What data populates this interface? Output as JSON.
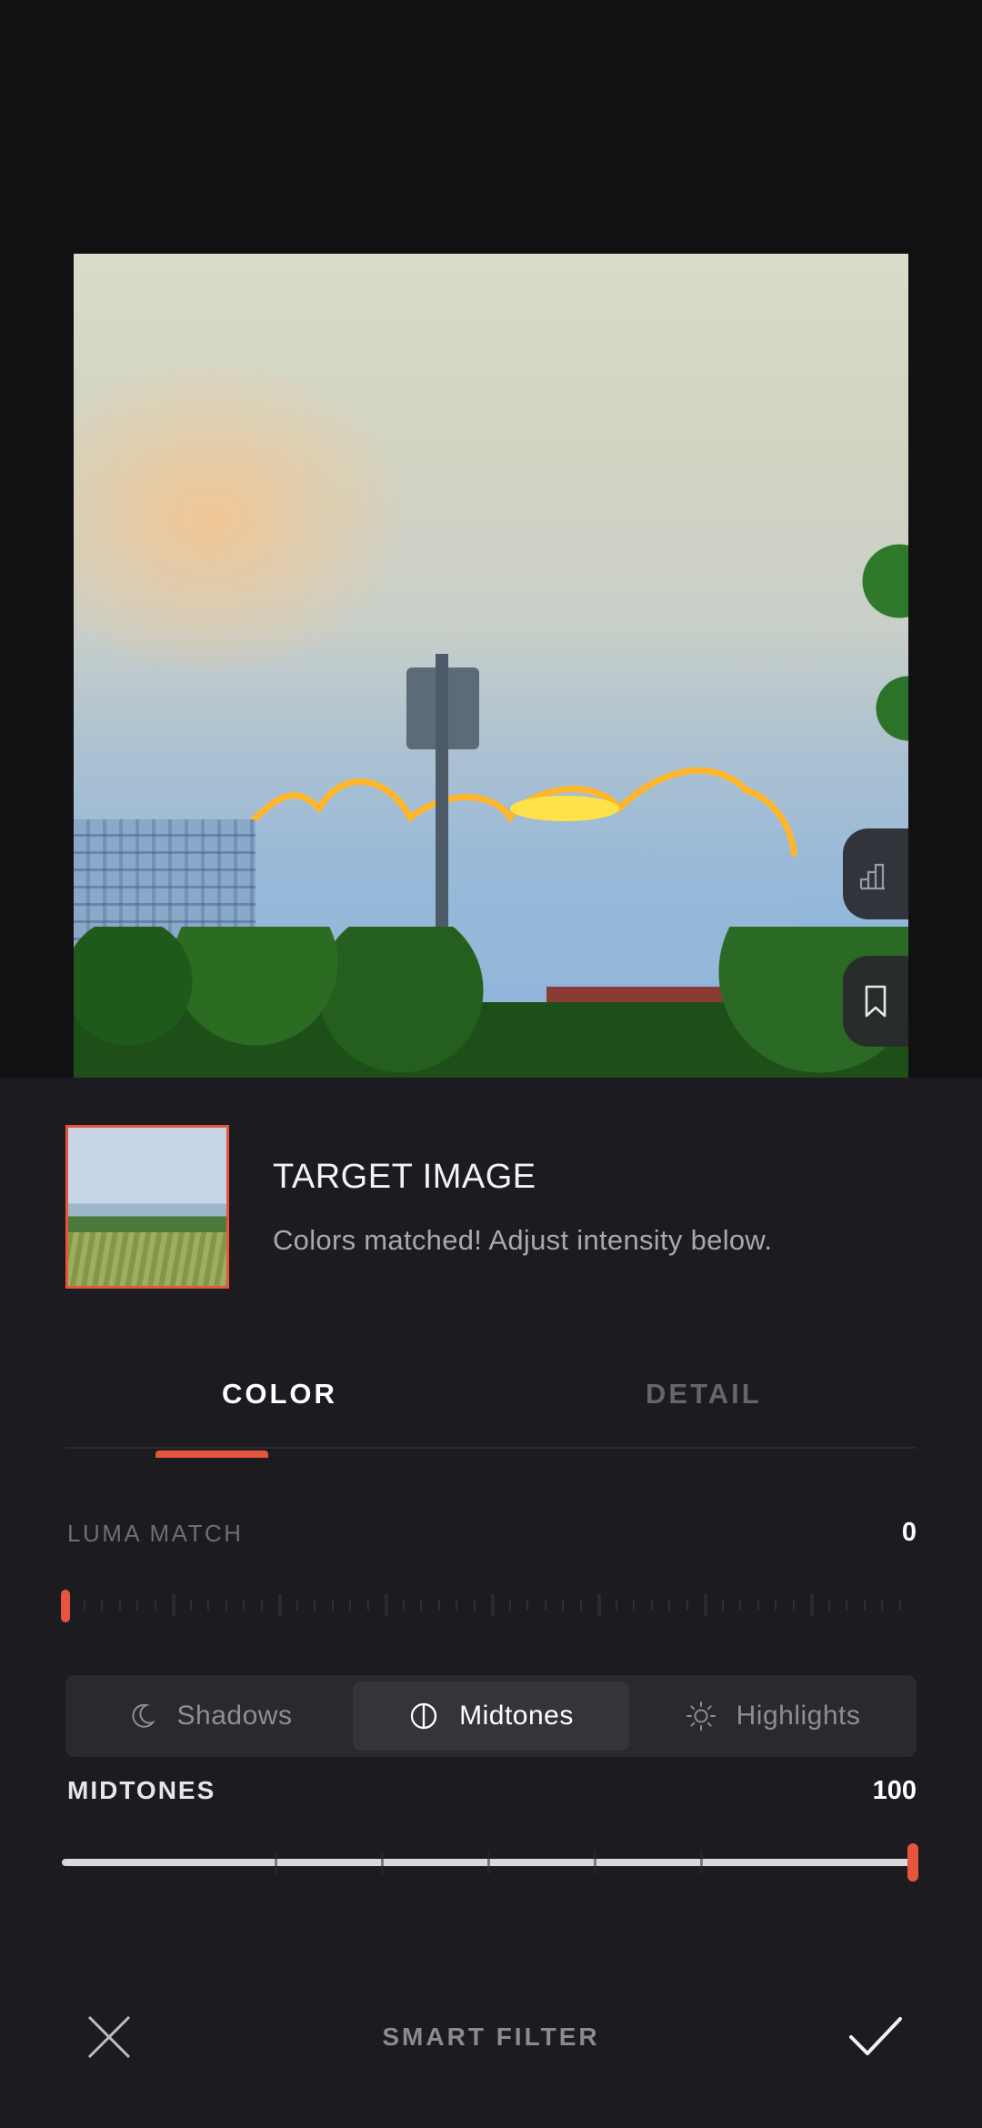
{
  "target": {
    "title": "TARGET IMAGE",
    "subtitle": "Colors matched! Adjust intensity below."
  },
  "tabs": [
    {
      "label": "COLOR",
      "active": true
    },
    {
      "label": "DETAIL",
      "active": false
    }
  ],
  "luma": {
    "label": "LUMA MATCH",
    "value": "0"
  },
  "segments": [
    {
      "label": "Shadows",
      "icon": "moon-icon"
    },
    {
      "label": "Midtones",
      "icon": "half-circle-icon",
      "active": true
    },
    {
      "label": "Highlights",
      "icon": "sun-icon"
    }
  ],
  "midtones": {
    "label": "MIDTONES",
    "value": "100"
  },
  "bottom": {
    "title": "SMART FILTER"
  },
  "colors": {
    "accent": "#e8553f",
    "panel": "#1c1b20",
    "background": "#111114"
  }
}
